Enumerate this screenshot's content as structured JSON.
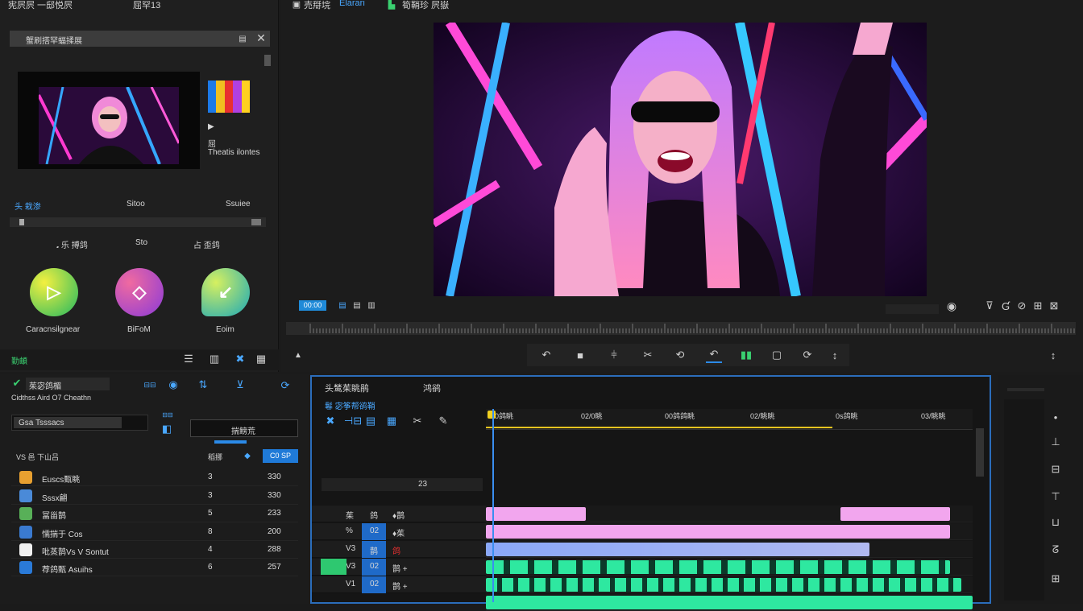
{
  "left_top": {
    "title_left": "宪屄屄  一邸悦屄",
    "title_right": "屈罕13",
    "tab_label": "蟹刷搭罕蝠揉展",
    "media_label_1": "▶",
    "media_label_2": "屈",
    "media_caption": "Theatis ilontes",
    "controls": [
      "头 栽渗",
      "Sitoo",
      "Ssuiee"
    ],
    "mini_labels": [
      "𝅘 乐 搏鸽",
      "Sto",
      "占 歪鸽"
    ],
    "circle_buttons": [
      {
        "label": "Caracnsilgnear",
        "glyph": "▷",
        "color": "#d9e11a"
      },
      {
        "label": "BiFoM",
        "glyph": "◇",
        "color": "#d75aa0"
      },
      {
        "label": "Eoim",
        "glyph": "↙",
        "color": "#33c0b0"
      }
    ],
    "bottom_label": "勤頔"
  },
  "monitor": {
    "title": "売搿垸",
    "title_accent": "Elarari",
    "title2": "筍鞘珍 屄嶽",
    "timecode_badge": "00:00",
    "tools": [
      "↶",
      "■",
      "⫩",
      "✂",
      "⟲",
      "↶",
      "▮▮",
      "▢",
      "⟳",
      "↕"
    ]
  },
  "left_bottom": {
    "header": "茱宓鸽楣",
    "subheader": "Cidthss Aird O7 Cheathn",
    "search_value": "Gsa   Tsssacs",
    "button_label": "揣鳑荒",
    "col_headers": [
      "VS 邑 下山吕",
      "稻挪",
      "C0 SP"
    ],
    "rows": [
      {
        "name": "Euscs甄眺",
        "n": "3",
        "v": "330",
        "color": "#e8a030"
      },
      {
        "name": "Sssx翩",
        "n": "3",
        "v": "330",
        "color": "#4a8ad8"
      },
      {
        "name": "冨甾鹊",
        "n": "5",
        "v": "233",
        "color": "#58b058"
      },
      {
        "name": "懦揣于 Cos",
        "n": "8",
        "v": "200",
        "color": "#3a7ad0"
      },
      {
        "name": "吡蒸鹊Vs  V Sontut",
        "n": "4",
        "v": "288",
        "color": "#f0f0f0"
      },
      {
        "name": "荐鸽甄 Asuihs",
        "n": "6",
        "v": "257",
        "color": "#2a7ad8"
      }
    ]
  },
  "timeline": {
    "title": "头鸶茱眺鹃",
    "title2": "鸿鹆",
    "sequence": "鬈 宓筝帮鹆鞘",
    "ruler_labels": [
      "00鸽眺",
      "02/0眺",
      "00鸽鸽眺",
      "02/眺眺",
      "0s鸽眺",
      "03/眺眺"
    ],
    "tracks": [
      {
        "a": "茱",
        "b": "鸽",
        "c": "♦鹊"
      },
      {
        "a": "%",
        "b": "02",
        "c": "♦茱"
      },
      {
        "a": "V3",
        "b": "鹊",
        "c": "鸽"
      },
      {
        "a": "V3",
        "b": "02",
        "c": "鹊 +"
      },
      {
        "a": "V1",
        "b": "02",
        "c": "鹊 +"
      }
    ]
  }
}
